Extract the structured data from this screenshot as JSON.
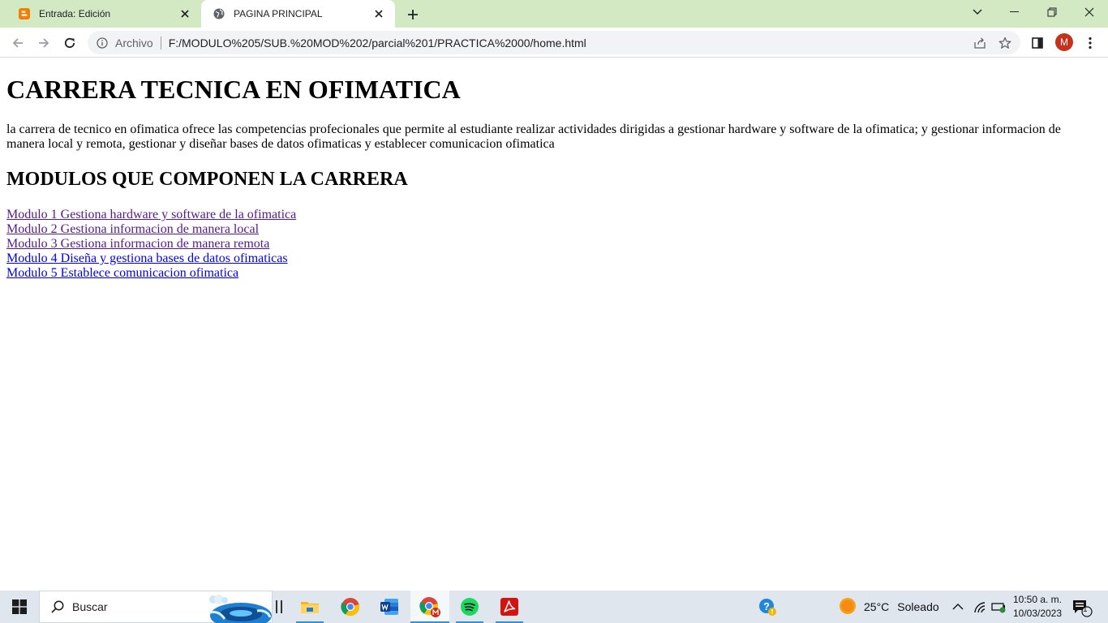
{
  "browser": {
    "tabs": [
      {
        "title": "Entrada: Edición",
        "favicon": "blogger-icon",
        "active": false
      },
      {
        "title": "PAGINA PRINCIPAL",
        "favicon": "globe-icon",
        "active": true
      }
    ],
    "omnibox": {
      "scheme_label": "Archivo",
      "url": "F:/MODULO%205/SUB.%20MOD%202/parcial%201/PRACTICA%2000/home.html"
    },
    "profile_initial": "M"
  },
  "page": {
    "title": "CARRERA TECNICA EN OFIMATICA",
    "description": "la carrera de tecnico en ofimatica ofrece las competencias profecionales que permite al estudiante realizar actividades dirigidas a gestionar hardware y software de la ofimatica; y gestionar informacion de manera local y remota, gestionar y diseñar bases de datos ofimaticas y establecer comunicacion ofimatica",
    "modules_heading": "MODULOS QUE COMPONEN LA CARRERA",
    "modules": [
      {
        "label": "Modulo 1 Gestiona hardware y software de la ofimatica",
        "visited": true
      },
      {
        "label": "Modulo 2 Gestiona informacion de manera local",
        "visited": true
      },
      {
        "label": "Modulo 3 Gestiona informacion de manera remota",
        "visited": true
      },
      {
        "label": "Modulo 4 Diseña y gestiona bases de datos ofimaticas",
        "visited": false
      },
      {
        "label": "Modulo 5 Establece comunicacion ofimatica",
        "visited": false
      }
    ]
  },
  "taskbar": {
    "search_placeholder": "Buscar",
    "apps": [
      "file-explorer-icon",
      "chrome-icon",
      "word-icon",
      "chrome-profile-icon",
      "spotify-icon",
      "acrobat-icon"
    ],
    "weather": {
      "temp": "25°C",
      "condition": "Soleado"
    },
    "time": "10:50 a. m.",
    "date": "10/03/2023",
    "notification_count": "1"
  },
  "colors": {
    "tabstrip": "#d2e9c4",
    "link_visited": "#551a8b",
    "link_unvisited": "#0000ee",
    "profile": "#c5311c"
  }
}
